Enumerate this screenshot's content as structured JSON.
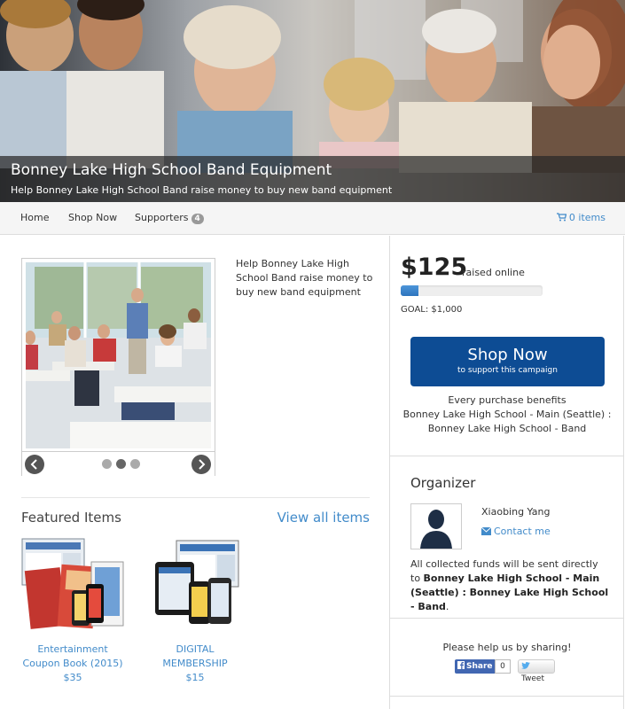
{
  "hero": {
    "title": "Bonney Lake High School Band Equipment",
    "subtitle": "Help Bonney Lake High School Band raise money to buy new band equipment"
  },
  "nav": {
    "home": "Home",
    "shop_now": "Shop Now",
    "supporters": "Supporters",
    "supporters_count": "4",
    "cart": "0 items"
  },
  "campaign": {
    "description": "Help Bonney Lake High School Band raise money to buy new band equipment"
  },
  "featured": {
    "title": "Featured Items",
    "view_all": "View all items",
    "items": [
      {
        "name": "Entertainment Coupon Book (2015)",
        "price": "$35"
      },
      {
        "name": "DIGITAL MEMBERSHIP",
        "price": "$15"
      }
    ]
  },
  "fundraising": {
    "amount": "$125",
    "raised_label": "raised online",
    "goal": "GOAL: $1,000",
    "progress_percent": 12.5
  },
  "shop_button": {
    "label": "Shop Now",
    "sublabel": "to support this campaign"
  },
  "benefits": {
    "line1": "Every purchase benefits",
    "line2": "Bonney Lake High School - Main (Seattle) :",
    "line3": "Bonney Lake High School - Band"
  },
  "organizer": {
    "title": "Organizer",
    "name": "Xiaobing Yang",
    "contact": "Contact me",
    "funds_text": "All collected funds will be sent directly to",
    "funds_recipient": "Bonney Lake High School - Main (Seattle) : Bonney Lake High School - Band",
    "funds_period": "."
  },
  "share": {
    "label": "Please help us by sharing!",
    "fb_share": "Share",
    "fb_count": "0",
    "tweet": "Tweet"
  },
  "colors": {
    "link": "#428bca",
    "shop_button": "#0d4c94",
    "progress": "#2d74bd"
  },
  "icons": {
    "cart": "cart-icon",
    "envelope": "envelope-icon",
    "prev": "chevron-left-icon",
    "next": "chevron-right-icon",
    "twitter": "twitter-bird-icon",
    "facebook": "facebook-f-icon",
    "avatar": "person-silhouette-icon"
  }
}
